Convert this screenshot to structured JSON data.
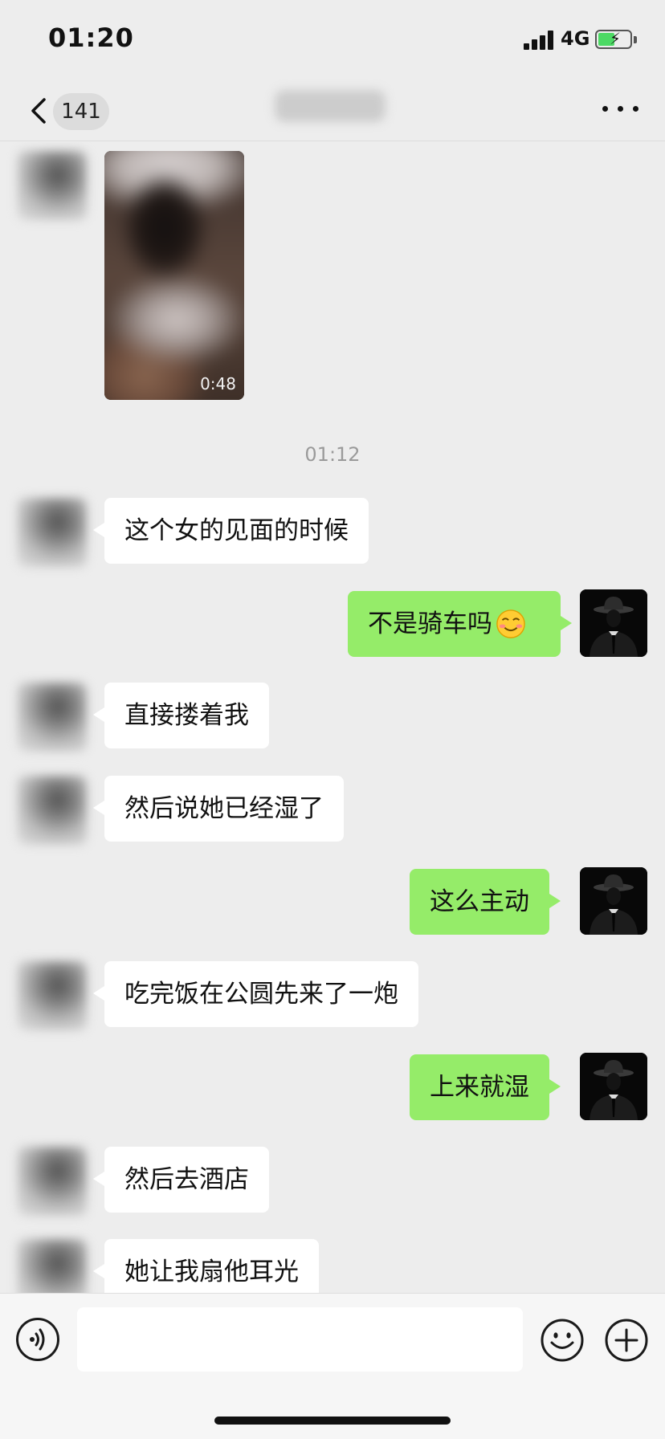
{
  "status_bar": {
    "time": "01:20",
    "network": "4G",
    "battery_level": 0.55
  },
  "nav": {
    "back_badge": "141"
  },
  "messages": {
    "video": {
      "duration": "0:48"
    },
    "time_divider": "01:12",
    "m1": "这个女的见面的时候",
    "m2": "不是骑车吗",
    "m3": "直接搂着我",
    "m4": "然后说她已经湿了",
    "m5": "这么主动",
    "m6": "吃完饭在公圆先来了一炮",
    "m7": "上来就湿",
    "m8": "然后去酒店",
    "m9": "她让我扇他耳光"
  },
  "input": {
    "value": ""
  },
  "icons": {
    "back": "chevron-left-icon",
    "more": "more-dots-icon",
    "voice": "voice-icon",
    "emoji": "emoji-icon",
    "plus": "plus-icon",
    "message_emoji": "smile-emoji"
  },
  "colors": {
    "background": "#ededed",
    "incoming_bubble": "#ffffff",
    "outgoing_bubble": "#95ec69",
    "battery": "#4cd964"
  }
}
